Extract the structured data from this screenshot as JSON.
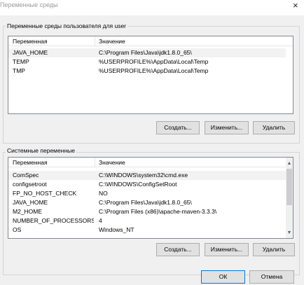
{
  "window": {
    "title": "Переменные среды",
    "close_glyph": "×"
  },
  "user_vars": {
    "group_label": "Переменные среды пользователя для user",
    "col_name": "Переменная",
    "col_value": "Значение",
    "rows": [
      {
        "name": "JAVA_HOME",
        "value": "C:\\Program Files\\Java\\jdk1.8.0_65\\"
      },
      {
        "name": "TEMP",
        "value": "%USERPROFILE%\\AppData\\Local\\Temp"
      },
      {
        "name": "TMP",
        "value": "%USERPROFILE%\\AppData\\Local\\Temp"
      }
    ],
    "new_label": "Создать...",
    "edit_label": "Изменить...",
    "delete_label": "Удалить"
  },
  "system_vars": {
    "group_label": "Системные переменные",
    "col_name": "Переменная",
    "col_value": "Значение",
    "rows": [
      {
        "name": "ComSpec",
        "value": "C:\\WINDOWS\\system32\\cmd.exe"
      },
      {
        "name": "configsetroot",
        "value": "C:\\WINDOWS\\ConfigSetRoot"
      },
      {
        "name": "FP_NO_HOST_CHECK",
        "value": "NO"
      },
      {
        "name": "JAVA_HOME",
        "value": "C:\\Program Files\\Java\\jdk1.8.0_65\\"
      },
      {
        "name": "M2_HOME",
        "value": "C:\\Program Files (x86)\\apache-maven-3.3.3\\"
      },
      {
        "name": "NUMBER_OF_PROCESSORS",
        "value": "4"
      },
      {
        "name": "OS",
        "value": "Windows_NT"
      }
    ],
    "new_label": "Создать...",
    "edit_label": "Изменить...",
    "delete_label": "Удалить",
    "scroll_up_icon": "▲",
    "scroll_down_icon": "▼"
  },
  "footer": {
    "ok_label": "ОК",
    "cancel_label": "Отмена"
  }
}
